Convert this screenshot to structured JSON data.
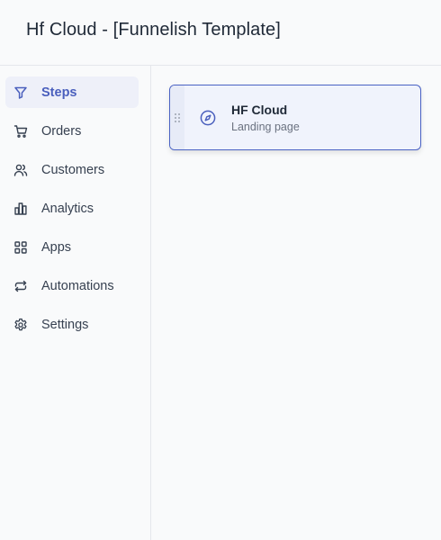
{
  "header": {
    "title": "Hf Cloud - [Funnelish Template]"
  },
  "sidebar": {
    "items": [
      {
        "label": "Steps",
        "icon": "funnel-icon",
        "active": true
      },
      {
        "label": "Orders",
        "icon": "cart-icon",
        "active": false
      },
      {
        "label": "Customers",
        "icon": "users-icon",
        "active": false
      },
      {
        "label": "Analytics",
        "icon": "bar-chart-icon",
        "active": false
      },
      {
        "label": "Apps",
        "icon": "grid-icon",
        "active": false
      },
      {
        "label": "Automations",
        "icon": "repeat-icon",
        "active": false
      },
      {
        "label": "Settings",
        "icon": "gear-icon",
        "active": false
      }
    ]
  },
  "main": {
    "steps": [
      {
        "title": "HF Cloud",
        "subtitle": "Landing page",
        "icon": "compass-icon"
      }
    ]
  },
  "colors": {
    "accent": "#4a5fbd",
    "active_bg": "#eef0f9",
    "card_bg": "#f0f3fc",
    "card_border": "#4a62c4",
    "background": "#f9fafb"
  }
}
